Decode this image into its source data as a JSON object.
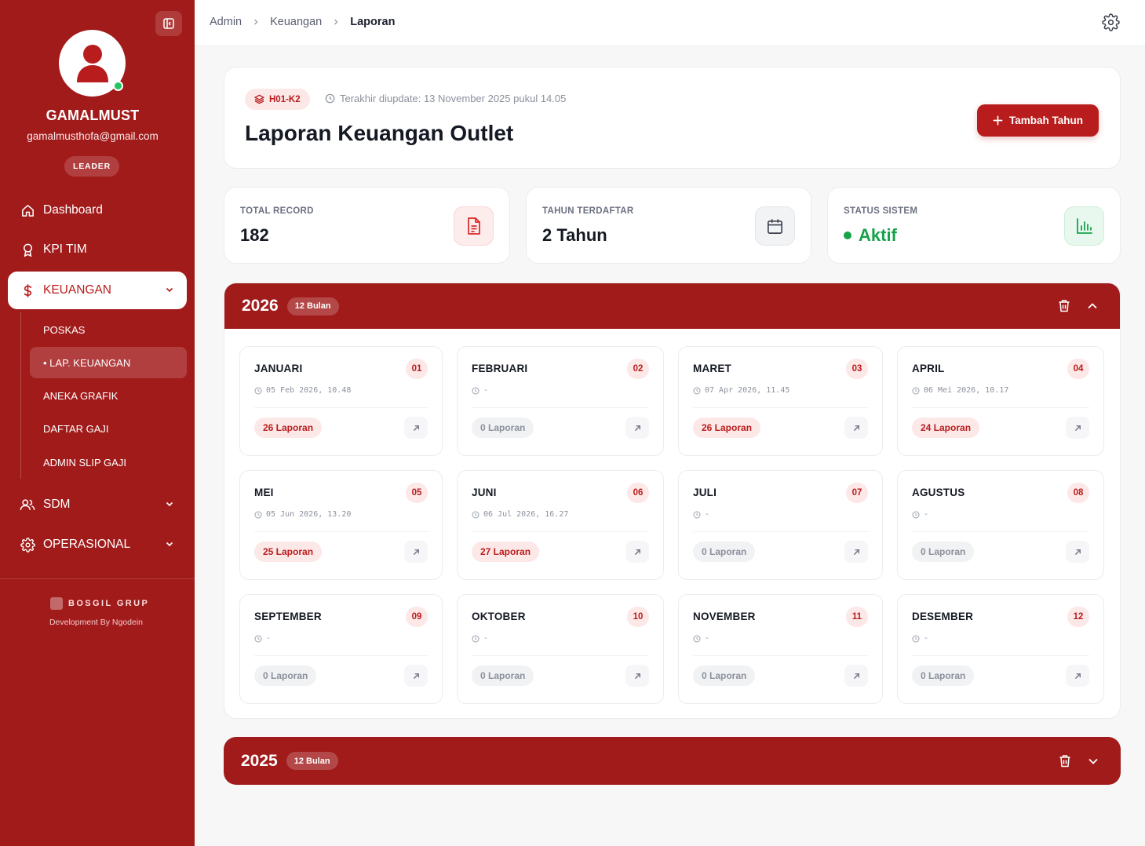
{
  "sidebar": {
    "user": {
      "name": "GAMALMUST",
      "email": "gamalmusthofa@gmail.com",
      "role": "LEADER"
    },
    "nav": {
      "dashboard": "Dashboard",
      "kpi": "KPI TIM",
      "keuangan": "KEUANGAN",
      "sdm": "SDM",
      "operasional": "OPERASIONAL"
    },
    "sub": {
      "poskas": "POSKAS",
      "lap_keuangan": "• LAP. KEUANGAN",
      "aneka_grafik": "ANEKA GRAFIK",
      "daftar_gaji": "DAFTAR GAJI",
      "admin_slip": "ADMIN SLIP GAJI"
    },
    "brand": "BOSGIL GRUP",
    "dev": "Development By Ngodein"
  },
  "breadcrumb": [
    "Admin",
    "Keuangan",
    "Laporan"
  ],
  "header": {
    "code": "H01-K2",
    "updated": "Terakhir diupdate: 13 November 2025 pukul 14.05",
    "title": "Laporan Keuangan Outlet",
    "add_button": "Tambah Tahun"
  },
  "stats": {
    "total_record": {
      "label": "TOTAL RECORD",
      "value": "182"
    },
    "tahun": {
      "label": "TAHUN TERDAFTAR",
      "value": "2 Tahun"
    },
    "status": {
      "label": "STATUS SISTEM",
      "value": "Aktif"
    }
  },
  "colors": {
    "primary": "#a21b1b",
    "accent": "#b91c1c",
    "success": "#16a34a"
  },
  "years": [
    {
      "year": "2026",
      "badge": "12 Bulan",
      "months": [
        {
          "name": "JANUARI",
          "num": "01",
          "date": "05 Feb 2026, 10.48",
          "count": "26 Laporan"
        },
        {
          "name": "FEBRUARI",
          "num": "02",
          "date": "-",
          "count": "0 Laporan"
        },
        {
          "name": "MARET",
          "num": "03",
          "date": "07 Apr 2026, 11.45",
          "count": "26 Laporan"
        },
        {
          "name": "APRIL",
          "num": "04",
          "date": "06 Mei 2026, 10.17",
          "count": "24 Laporan"
        },
        {
          "name": "MEI",
          "num": "05",
          "date": "05 Jun 2026, 13.20",
          "count": "25 Laporan"
        },
        {
          "name": "JUNI",
          "num": "06",
          "date": "06 Jul 2026, 16.27",
          "count": "27 Laporan"
        },
        {
          "name": "JULI",
          "num": "07",
          "date": "-",
          "count": "0 Laporan"
        },
        {
          "name": "AGUSTUS",
          "num": "08",
          "date": "-",
          "count": "0 Laporan"
        },
        {
          "name": "SEPTEMBER",
          "num": "09",
          "date": "-",
          "count": "0 Laporan"
        },
        {
          "name": "OKTOBER",
          "num": "10",
          "date": "-",
          "count": "0 Laporan"
        },
        {
          "name": "NOVEMBER",
          "num": "11",
          "date": "-",
          "count": "0 Laporan"
        },
        {
          "name": "DESEMBER",
          "num": "12",
          "date": "-",
          "count": "0 Laporan"
        }
      ]
    },
    {
      "year": "2025",
      "badge": "12 Bulan"
    }
  ]
}
